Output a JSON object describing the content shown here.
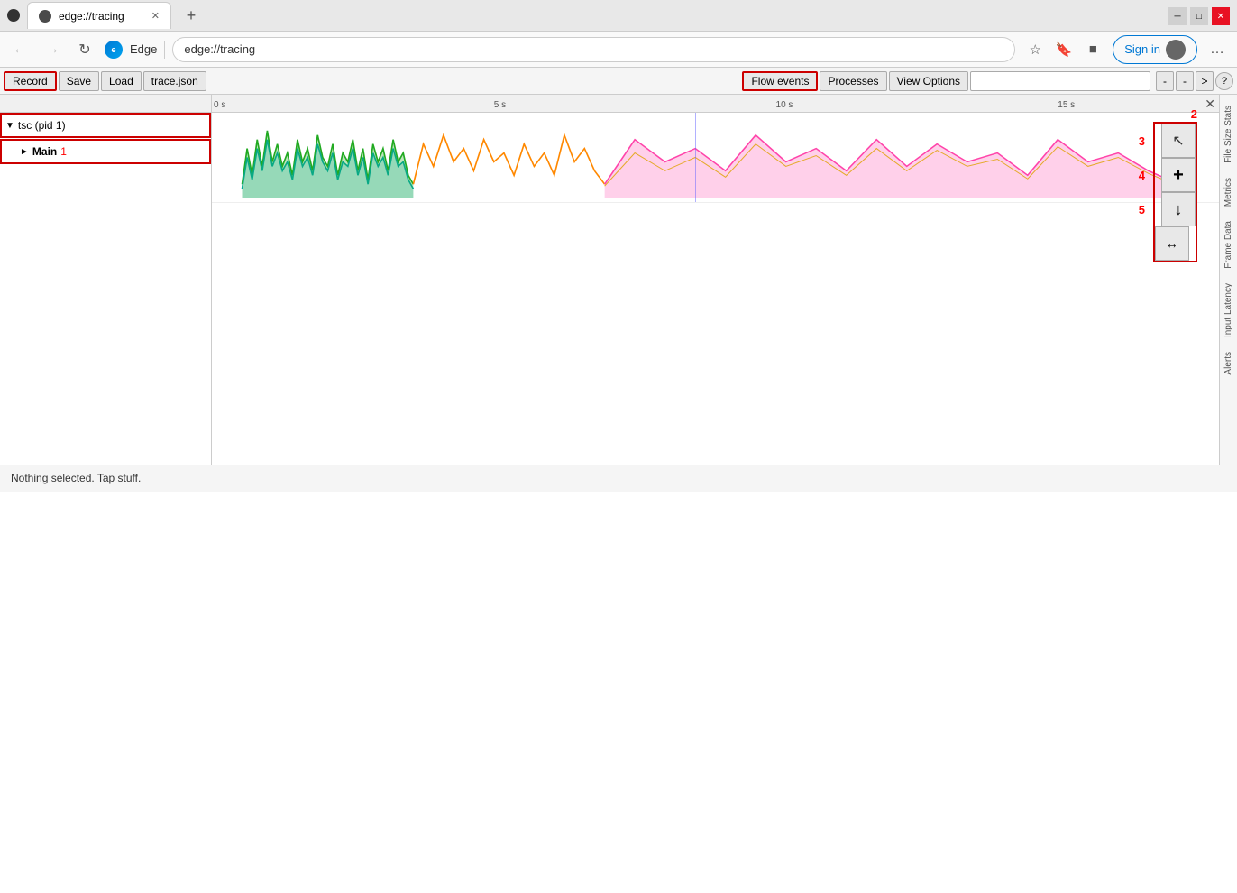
{
  "browser": {
    "tab_title": "edge://tracing",
    "tab_favicon": "●",
    "url": "edge://tracing",
    "browser_name": "Edge",
    "sign_in_label": "Sign in",
    "new_tab_icon": "+",
    "back_disabled": true,
    "forward_disabled": true
  },
  "toolbar": {
    "record_label": "Record",
    "save_label": "Save",
    "load_label": "Load",
    "trace_json_label": "trace.json",
    "flow_events_label": "Flow events",
    "processes_label": "Processes",
    "view_options_label": "View Options",
    "help_label": "?"
  },
  "timeline": {
    "ruler_ticks": [
      "0 s",
      "5 s",
      "10 s",
      "15 s"
    ],
    "process_label": "tsc (pid 1)",
    "thread_label": "Main",
    "number_1": "1",
    "number_2": "2",
    "number_3": "3",
    "number_4": "4",
    "number_5": "5"
  },
  "controls": {
    "select_icon": "↖",
    "zoom_in_icon": "+",
    "zoom_out_icon": "↓",
    "fit_icon": "↔"
  },
  "sidebar_tabs": {
    "file_size": "File Size Stats",
    "metrics": "Metrics",
    "frame_data": "Frame Data",
    "input_latency": "Input Latency",
    "alerts": "Alerts"
  },
  "status_bar": {
    "message": "Nothing selected. Tap stuff."
  },
  "window_controls": {
    "minimize": "─",
    "maximize": "□",
    "close": "✕"
  }
}
